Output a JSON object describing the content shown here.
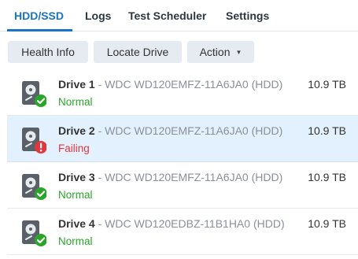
{
  "tabs": [
    {
      "label": "HDD/SSD"
    },
    {
      "label": "Logs"
    },
    {
      "label": "Test Scheduler"
    },
    {
      "label": "Settings"
    }
  ],
  "toolbar": {
    "health_info": "Health Info",
    "locate_drive": "Locate Drive",
    "action": "Action"
  },
  "drives": [
    {
      "name": "Drive 1",
      "model": "WDC WD120EMFZ-11A6JA0 (HDD)",
      "size": "10.9 TB",
      "status": "Normal"
    },
    {
      "name": "Drive 2",
      "model": "WDC WD120EMFZ-11A6JA0 (HDD)",
      "size": "10.9 TB",
      "status": "Failing"
    },
    {
      "name": "Drive 3",
      "model": "WDC WD120EMFZ-11A6JA0 (HDD)",
      "size": "10.9 TB",
      "status": "Normal"
    },
    {
      "name": "Drive 4",
      "model": "WDC WD120EDBZ-11B1HA0 (HDD)",
      "size": "10.9 TB",
      "status": "Normal"
    }
  ],
  "colors": {
    "accent": "#1a73c8",
    "normal": "#2aa52a",
    "failing": "#e0373f",
    "selected_row": "#e3f0fd"
  }
}
